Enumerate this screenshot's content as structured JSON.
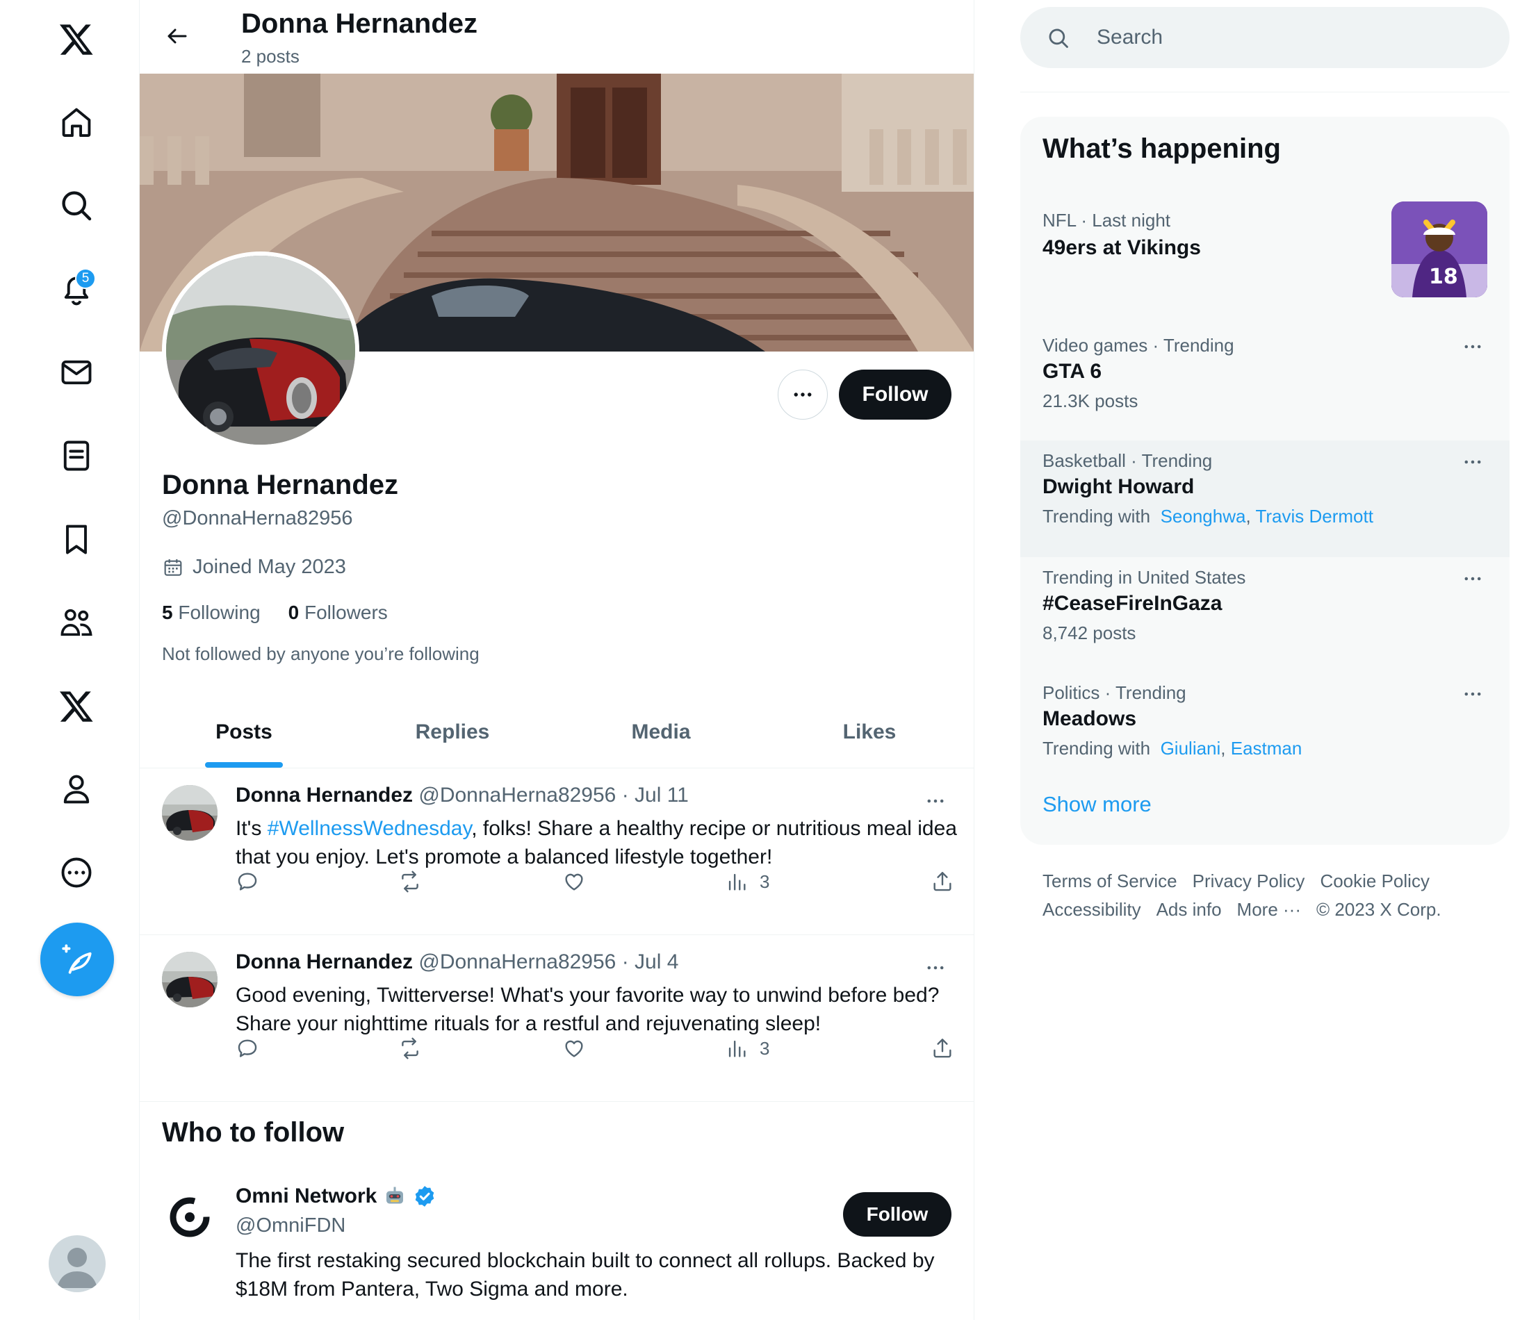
{
  "nav": {
    "notification_count": "5"
  },
  "header": {
    "name": "Donna Hernandez",
    "post_count": "2 posts"
  },
  "profile": {
    "name": "Donna Hernandez",
    "handle": "@DonnaHerna82956",
    "joined": "Joined May 2023",
    "following_count": "5",
    "following_label": "Following",
    "followers_count": "0",
    "followers_label": "Followers",
    "not_followed": "Not followed by anyone you’re following",
    "follow_label": "Follow"
  },
  "tabs": [
    {
      "label": "Posts",
      "active": true
    },
    {
      "label": "Replies"
    },
    {
      "label": "Media"
    },
    {
      "label": "Likes"
    }
  ],
  "posts": [
    {
      "name": "Donna Hernandez",
      "meta": "@DonnaHerna82956 · Jul 11",
      "text_before": "It's ",
      "hashtag": "#WellnessWednesday",
      "text_after": ", folks! Share a healthy recipe or nutritious meal idea that you enjoy. Let's promote a balanced lifestyle together!",
      "views": "3"
    },
    {
      "name": "Donna Hernandez",
      "meta": "@DonnaHerna82956 · Jul 4",
      "text_before": "Good evening, Twitterverse! What's your favorite way to unwind before bed? Share your nighttime rituals for a restful and rejuvenating sleep!",
      "hashtag": "",
      "text_after": "",
      "views": "3"
    }
  ],
  "who_to_follow": {
    "title": "Who to follow",
    "name": "Omni Network",
    "handle": "@OmniFDN",
    "bio": "The first restaking secured blockchain built to connect all rollups. Backed by $18M from Pantera, Two Sigma and more.",
    "follow_label": "Follow"
  },
  "search": {
    "placeholder": "Search"
  },
  "trends": {
    "title": "What’s happening",
    "items": [
      {
        "meta": "NFL · Last night",
        "name": "49ers at Vikings",
        "sub": ""
      },
      {
        "meta": "Video games · Trending",
        "name": "GTA 6",
        "sub": "21.3K posts"
      },
      {
        "meta": "Basketball · Trending",
        "name": "Dwight Howard",
        "sub_prefix": "Trending with",
        "links": [
          "Seonghwa",
          "Travis Dermott"
        ]
      },
      {
        "meta": "Trending in United States",
        "name": "#CeaseFireInGaza",
        "sub": "8,742 posts"
      },
      {
        "meta": "Politics · Trending",
        "name": "Meadows",
        "sub_prefix": "Trending with",
        "links": [
          "Giuliani",
          "Eastman"
        ]
      }
    ],
    "show_more": "Show more"
  },
  "footer": {
    "links": [
      "Terms of Service",
      "Privacy Policy",
      "Cookie Policy",
      "Accessibility",
      "Ads info",
      "More ···"
    ],
    "copyright": "© 2023 X Corp."
  },
  "colors": {
    "accent": "#1d9bf0",
    "text": "#0f1419",
    "muted": "#536471"
  }
}
